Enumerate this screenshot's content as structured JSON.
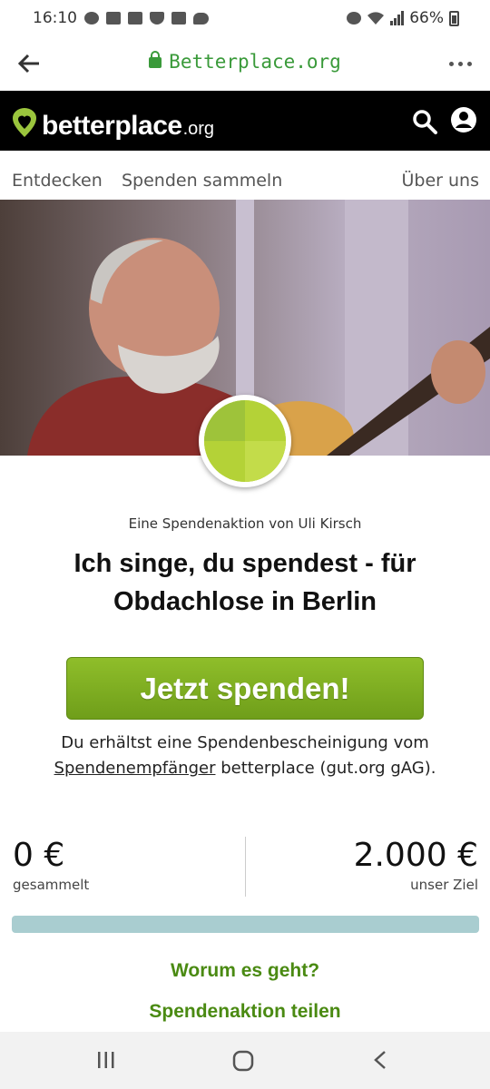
{
  "status_bar": {
    "time": "16:10",
    "battery": "66%",
    "notification_icons": [
      "whatsapp-icon",
      "mail-icon",
      "mail-icon",
      "shield-icon",
      "image-icon",
      "twitter-icon"
    ],
    "system_icons": [
      "alarm-icon",
      "wifi-icon",
      "signal-icon",
      "battery-icon"
    ]
  },
  "browser": {
    "url": "Betterplace.org"
  },
  "site_header": {
    "logo_text": "betterplace",
    "logo_tld": ".org",
    "accent_color": "#9bc53d"
  },
  "nav": {
    "items": [
      "Entdecken",
      "Spenden sammeln",
      "Über uns"
    ]
  },
  "campaign": {
    "subtitle": "Eine Spendenaktion von Uli Kirsch",
    "title": "Ich singe, du spendest - für Obdachlose in Berlin",
    "donate_label": "Jetzt spenden!",
    "info_prefix": "Du erhältst eine Spendenbescheinigung vom ",
    "info_link": "Spendenempfänger",
    "info_suffix": " betterplace (gut.org gAG).",
    "collected_value": "0 €",
    "collected_label": "gesammelt",
    "goal_value": "2.000 €",
    "goal_label": "unser Ziel",
    "progress_fraction": 0,
    "link_about": "Worum es geht?",
    "link_share": "Spendenaktion teilen"
  }
}
